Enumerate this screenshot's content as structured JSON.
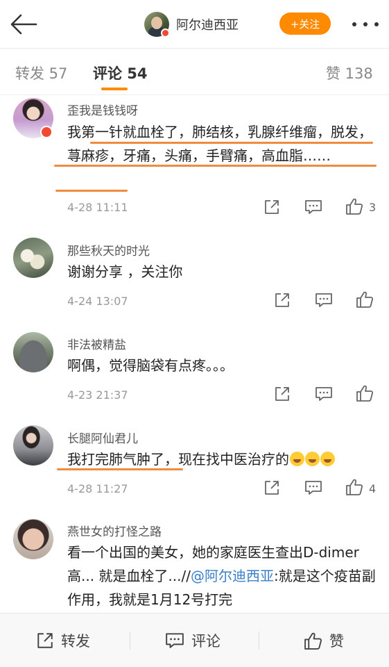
{
  "header": {
    "username": "阿尔迪西亚",
    "follow_label": "+关注"
  },
  "tabs": [
    {
      "label": "转发 57"
    },
    {
      "label": "评论 54"
    },
    {
      "label": "赞 138"
    }
  ],
  "comments": [
    {
      "name": "歪我是钱钱呀",
      "text": "我第一针就血栓了，肺结核，乳腺纤维瘤，脱发，荨麻疹，牙痛，头痛，手臂痛，高血脂……",
      "time": "4-28 11:11",
      "likes": "3"
    },
    {
      "name": "那些秋天的时光",
      "text": "谢谢分享 ，关注你",
      "time": "4-24 13:07",
      "likes": ""
    },
    {
      "name": "非法被精盐",
      "text": "啊偶，觉得脑袋有点疼。。。",
      "time": "4-23 21:37",
      "likes": ""
    },
    {
      "name": "长腿阿仙君儿",
      "text": "我打完肺气肿了，现在找中医治疗的",
      "time": "4-28 11:27",
      "likes": "4"
    },
    {
      "name": "燕世女的打怪之路",
      "text_before": "看一个出国的美女，她的家庭医生查出D-dimer 高... 就是血栓了...//",
      "mention": "@阿尔迪西亚",
      "text_after": ":就是这个疫苗副作用，我就是1月12号打完"
    }
  ],
  "bottom_bar": {
    "repost_label": "转发",
    "comment_label": "评论",
    "like_label": "赞"
  },
  "colors": {
    "accent": "#ff8a00",
    "underline": "#f08a3c",
    "mention": "#3a7ec9"
  }
}
